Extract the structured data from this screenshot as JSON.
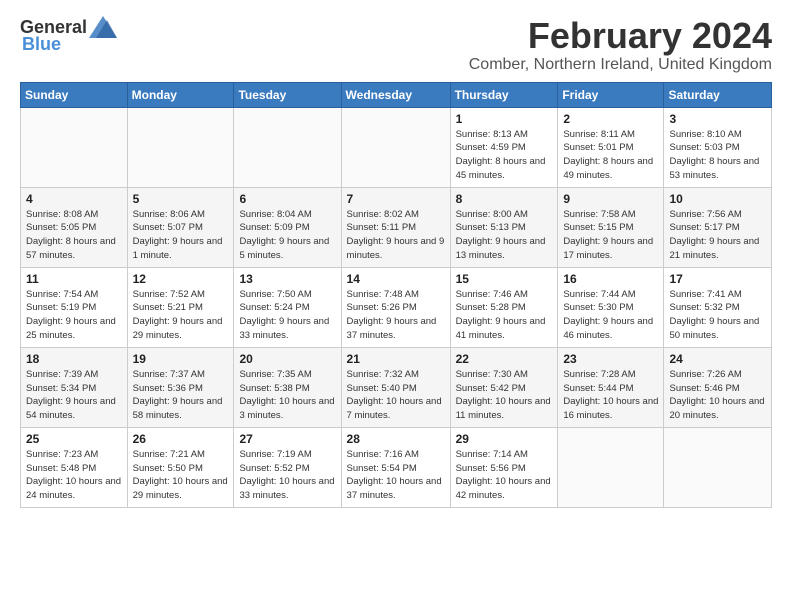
{
  "header": {
    "logo_general": "General",
    "logo_blue": "Blue",
    "month_title": "February 2024",
    "subtitle": "Comber, Northern Ireland, United Kingdom"
  },
  "calendar": {
    "days_of_week": [
      "Sunday",
      "Monday",
      "Tuesday",
      "Wednesday",
      "Thursday",
      "Friday",
      "Saturday"
    ],
    "weeks": [
      [
        {
          "day": "",
          "info": ""
        },
        {
          "day": "",
          "info": ""
        },
        {
          "day": "",
          "info": ""
        },
        {
          "day": "",
          "info": ""
        },
        {
          "day": "1",
          "info": "Sunrise: 8:13 AM\nSunset: 4:59 PM\nDaylight: 8 hours and 45 minutes."
        },
        {
          "day": "2",
          "info": "Sunrise: 8:11 AM\nSunset: 5:01 PM\nDaylight: 8 hours and 49 minutes."
        },
        {
          "day": "3",
          "info": "Sunrise: 8:10 AM\nSunset: 5:03 PM\nDaylight: 8 hours and 53 minutes."
        }
      ],
      [
        {
          "day": "4",
          "info": "Sunrise: 8:08 AM\nSunset: 5:05 PM\nDaylight: 8 hours and 57 minutes."
        },
        {
          "day": "5",
          "info": "Sunrise: 8:06 AM\nSunset: 5:07 PM\nDaylight: 9 hours and 1 minute."
        },
        {
          "day": "6",
          "info": "Sunrise: 8:04 AM\nSunset: 5:09 PM\nDaylight: 9 hours and 5 minutes."
        },
        {
          "day": "7",
          "info": "Sunrise: 8:02 AM\nSunset: 5:11 PM\nDaylight: 9 hours and 9 minutes."
        },
        {
          "day": "8",
          "info": "Sunrise: 8:00 AM\nSunset: 5:13 PM\nDaylight: 9 hours and 13 minutes."
        },
        {
          "day": "9",
          "info": "Sunrise: 7:58 AM\nSunset: 5:15 PM\nDaylight: 9 hours and 17 minutes."
        },
        {
          "day": "10",
          "info": "Sunrise: 7:56 AM\nSunset: 5:17 PM\nDaylight: 9 hours and 21 minutes."
        }
      ],
      [
        {
          "day": "11",
          "info": "Sunrise: 7:54 AM\nSunset: 5:19 PM\nDaylight: 9 hours and 25 minutes."
        },
        {
          "day": "12",
          "info": "Sunrise: 7:52 AM\nSunset: 5:21 PM\nDaylight: 9 hours and 29 minutes."
        },
        {
          "day": "13",
          "info": "Sunrise: 7:50 AM\nSunset: 5:24 PM\nDaylight: 9 hours and 33 minutes."
        },
        {
          "day": "14",
          "info": "Sunrise: 7:48 AM\nSunset: 5:26 PM\nDaylight: 9 hours and 37 minutes."
        },
        {
          "day": "15",
          "info": "Sunrise: 7:46 AM\nSunset: 5:28 PM\nDaylight: 9 hours and 41 minutes."
        },
        {
          "day": "16",
          "info": "Sunrise: 7:44 AM\nSunset: 5:30 PM\nDaylight: 9 hours and 46 minutes."
        },
        {
          "day": "17",
          "info": "Sunrise: 7:41 AM\nSunset: 5:32 PM\nDaylight: 9 hours and 50 minutes."
        }
      ],
      [
        {
          "day": "18",
          "info": "Sunrise: 7:39 AM\nSunset: 5:34 PM\nDaylight: 9 hours and 54 minutes."
        },
        {
          "day": "19",
          "info": "Sunrise: 7:37 AM\nSunset: 5:36 PM\nDaylight: 9 hours and 58 minutes."
        },
        {
          "day": "20",
          "info": "Sunrise: 7:35 AM\nSunset: 5:38 PM\nDaylight: 10 hours and 3 minutes."
        },
        {
          "day": "21",
          "info": "Sunrise: 7:32 AM\nSunset: 5:40 PM\nDaylight: 10 hours and 7 minutes."
        },
        {
          "day": "22",
          "info": "Sunrise: 7:30 AM\nSunset: 5:42 PM\nDaylight: 10 hours and 11 minutes."
        },
        {
          "day": "23",
          "info": "Sunrise: 7:28 AM\nSunset: 5:44 PM\nDaylight: 10 hours and 16 minutes."
        },
        {
          "day": "24",
          "info": "Sunrise: 7:26 AM\nSunset: 5:46 PM\nDaylight: 10 hours and 20 minutes."
        }
      ],
      [
        {
          "day": "25",
          "info": "Sunrise: 7:23 AM\nSunset: 5:48 PM\nDaylight: 10 hours and 24 minutes."
        },
        {
          "day": "26",
          "info": "Sunrise: 7:21 AM\nSunset: 5:50 PM\nDaylight: 10 hours and 29 minutes."
        },
        {
          "day": "27",
          "info": "Sunrise: 7:19 AM\nSunset: 5:52 PM\nDaylight: 10 hours and 33 minutes."
        },
        {
          "day": "28",
          "info": "Sunrise: 7:16 AM\nSunset: 5:54 PM\nDaylight: 10 hours and 37 minutes."
        },
        {
          "day": "29",
          "info": "Sunrise: 7:14 AM\nSunset: 5:56 PM\nDaylight: 10 hours and 42 minutes."
        },
        {
          "day": "",
          "info": ""
        },
        {
          "day": "",
          "info": ""
        }
      ]
    ]
  }
}
